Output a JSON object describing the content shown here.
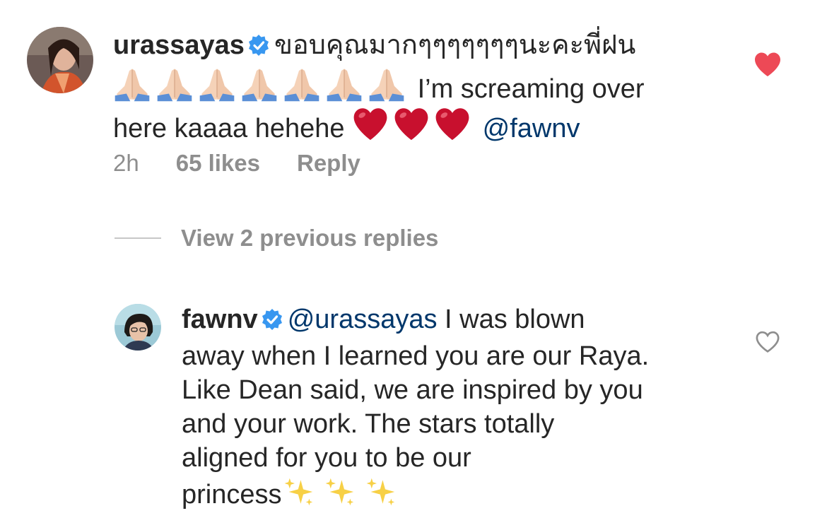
{
  "comment1": {
    "username": "urassayas",
    "text_thai": "ขอบคุณมากๆๆๆๆๆๆๆนะคะพี่ฝน",
    "text_line2": "I’m screaming over",
    "text_line3": "here kaaaa hehehe",
    "mention": "@fawnv",
    "time": "2h",
    "likes": "65 likes",
    "reply": "Reply",
    "liked": true,
    "emoji_pray_count": 7,
    "emoji_heart_count": 3
  },
  "view_replies": "View 2 previous replies",
  "comment2": {
    "username": "fawnv",
    "mention": "@urassayas",
    "text_line1": "I was blown",
    "text_line2": "away when I learned you are our Raya.",
    "text_line3": "Like Dean said, we are inspired by you",
    "text_line4": "and your work. The stars totally",
    "text_line5": "aligned for you to be our",
    "text_line6": "princess",
    "liked": false,
    "emoji_sparkles_count": 3
  },
  "colors": {
    "verified": "#3897f0",
    "heart_liked": "#ed4956",
    "mention": "#00376b",
    "meta": "#8e8e8e"
  },
  "icons": [
    "verified-badge-icon",
    "heart-filled-icon",
    "heart-outline-icon",
    "folded-hands-emoji",
    "red-heart-emoji",
    "sparkles-emoji"
  ]
}
